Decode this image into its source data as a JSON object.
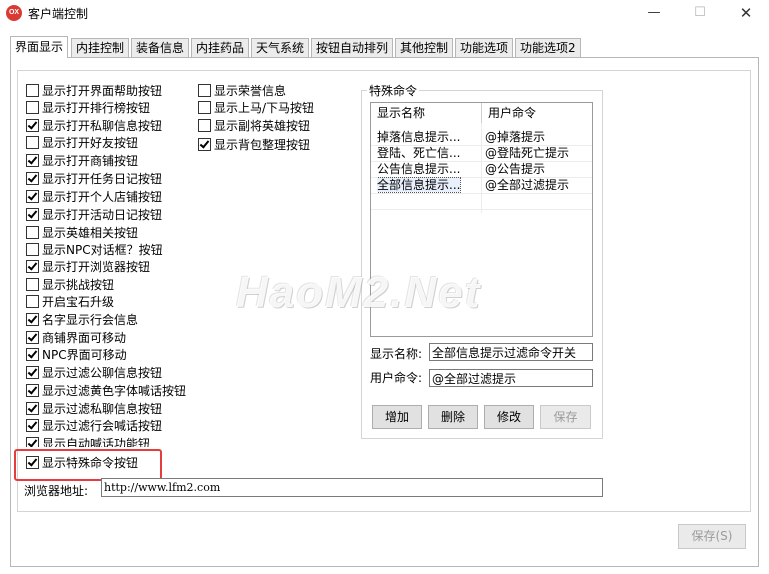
{
  "window": {
    "title": "客户端控制",
    "icon_text": "OX",
    "controls": {
      "minimize": "—",
      "maximize": "☐",
      "close": "✕"
    }
  },
  "tabs": [
    {
      "label": "界面显示",
      "active": true
    },
    {
      "label": "内挂控制",
      "active": false
    },
    {
      "label": "装备信息",
      "active": false
    },
    {
      "label": "内挂药品",
      "active": false
    },
    {
      "label": "天气系统",
      "active": false
    },
    {
      "label": "按钮自动排列",
      "active": false
    },
    {
      "label": "其他控制",
      "active": false
    },
    {
      "label": "功能选项",
      "active": false
    },
    {
      "label": "功能选项2",
      "active": false
    }
  ],
  "left_checkboxes": [
    {
      "label": "显示打开界面帮助按钮",
      "checked": false
    },
    {
      "label": "显示打开排行榜按钮",
      "checked": false
    },
    {
      "label": "显示打开私聊信息按钮",
      "checked": true
    },
    {
      "label": "显示打开好友按钮",
      "checked": false
    },
    {
      "label": "显示打开商铺按钮",
      "checked": true
    },
    {
      "label": "显示打开任务日记按钮",
      "checked": true
    },
    {
      "label": "显示打开个人店铺按钮",
      "checked": true
    },
    {
      "label": "显示打开活动日记按钮",
      "checked": true
    },
    {
      "label": "显示英雄相关按钮",
      "checked": false
    },
    {
      "label": "显示NPC对话框？按钮",
      "checked": false
    },
    {
      "label": "显示打开浏览器按钮",
      "checked": true
    },
    {
      "label": "显示挑战按钮",
      "checked": false
    },
    {
      "label": "开启宝石升级",
      "checked": false
    },
    {
      "label": "名字显示行会信息",
      "checked": true
    },
    {
      "label": "商铺界面可移动",
      "checked": true
    },
    {
      "label": "NPC界面可移动",
      "checked": true
    },
    {
      "label": "显示过滤公聊信息按钮",
      "checked": true
    },
    {
      "label": "显示过滤黄色字体喊话按钮",
      "checked": true
    },
    {
      "label": "显示过滤私聊信息按钮",
      "checked": true
    },
    {
      "label": "显示过滤行会喊话按钮",
      "checked": true
    },
    {
      "label": "显示自动喊话功能钮",
      "checked": true
    },
    {
      "label": "显示特殊命令按钮",
      "checked": true
    }
  ],
  "right_checkboxes": [
    {
      "label": "显示荣誉信息",
      "checked": false
    },
    {
      "label": "显示上马/下马按钮",
      "checked": false
    },
    {
      "label": "显示副将英雄按钮",
      "checked": false
    },
    {
      "label": "显示背包整理按钮",
      "checked": true
    }
  ],
  "special_commands": {
    "group_title": "特殊命令",
    "columns": [
      "显示名称",
      "用户命令"
    ],
    "rows": [
      {
        "name": "掉落信息提示...",
        "command": "@掉落提示",
        "selected": false
      },
      {
        "name": "登陆、死亡信...",
        "command": "@登陆死亡提示",
        "selected": false
      },
      {
        "name": "公告信息提示...",
        "command": "@公告提示",
        "selected": false
      },
      {
        "name": "全部信息提示...",
        "command": "@全部过滤提示",
        "selected": true
      }
    ],
    "display_name_label": "显示名称:",
    "display_name_value": "全部信息提示过滤命令开关",
    "user_command_label": "用户命令:",
    "user_command_value": "@全部过滤提示",
    "buttons": {
      "add": "增加",
      "delete": "删除",
      "modify": "修改",
      "save": "保存"
    }
  },
  "browser": {
    "label": "浏览器地址:",
    "url": "http://www.lfm2.com"
  },
  "footer": {
    "save_label": "保存(S)"
  },
  "watermark": "HaoM2.Net",
  "colors": {
    "highlight": "#e53c3c",
    "selected_row": "#e8f0fc"
  }
}
